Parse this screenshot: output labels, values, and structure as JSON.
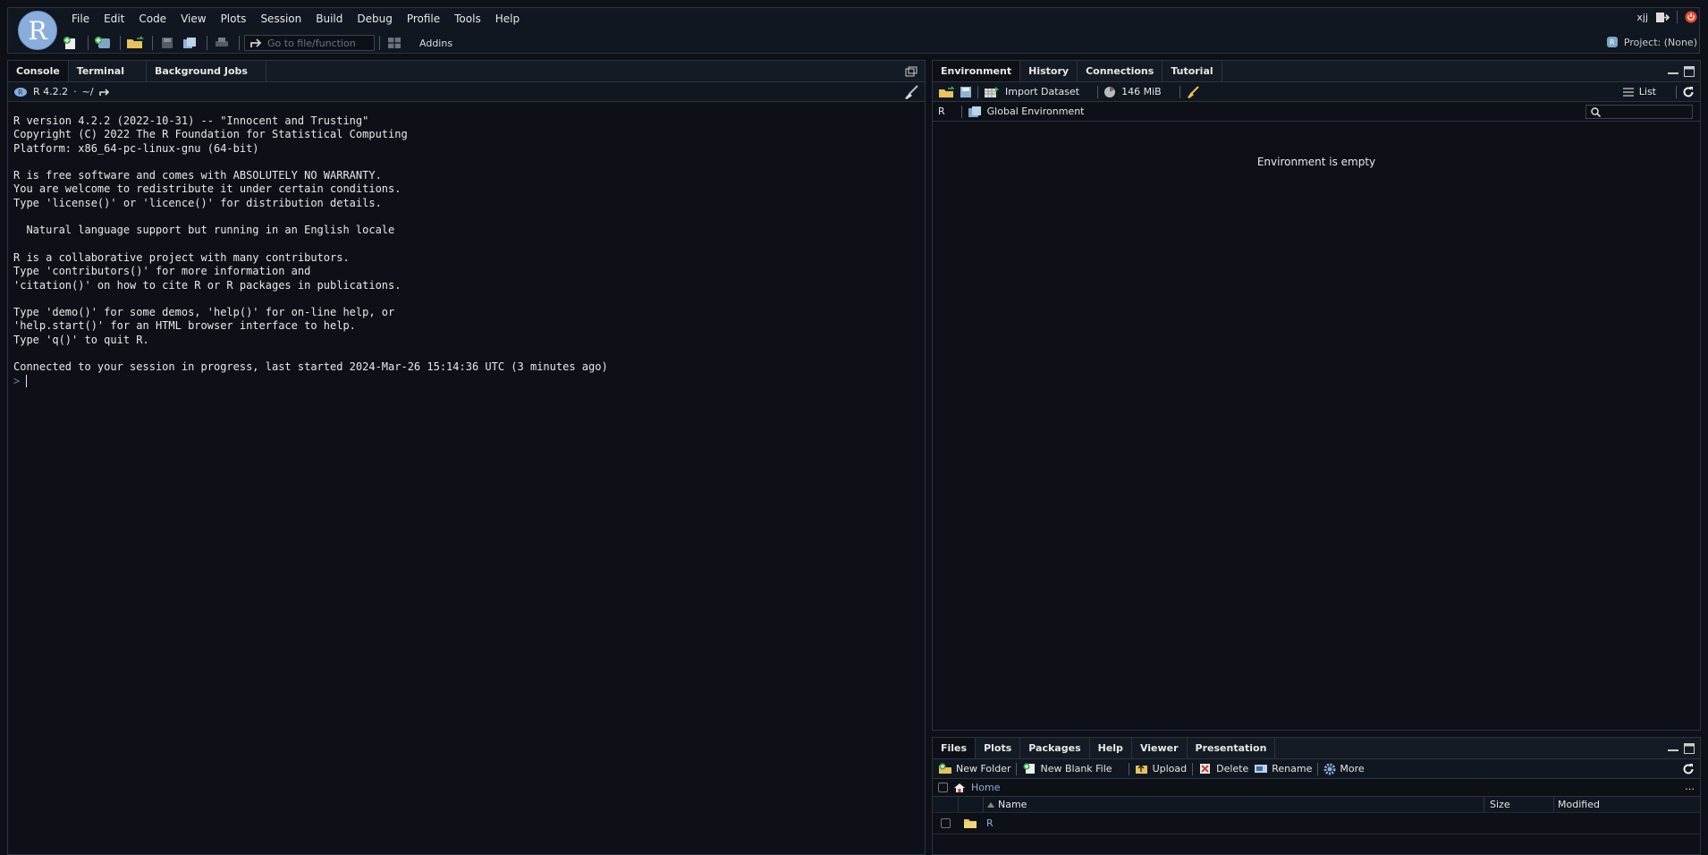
{
  "menu": [
    "File",
    "Edit",
    "Code",
    "View",
    "Plots",
    "Session",
    "Build",
    "Debug",
    "Profile",
    "Tools",
    "Help"
  ],
  "logo_letter": "R",
  "user": "xjj",
  "toolbar": {
    "goto_placeholder": "Go to file/function",
    "addins": "Addins"
  },
  "project": "Project: (None)",
  "console_pane": {
    "tabs": [
      "Console",
      "Terminal",
      "Background Jobs"
    ],
    "r_version": "R 4.2.2",
    "path": "~/",
    "output": "R version 4.2.2 (2022-10-31) -- \"Innocent and Trusting\"\nCopyright (C) 2022 The R Foundation for Statistical Computing\nPlatform: x86_64-pc-linux-gnu (64-bit)\n\nR is free software and comes with ABSOLUTELY NO WARRANTY.\nYou are welcome to redistribute it under certain conditions.\nType 'license()' or 'licence()' for distribution details.\n\n  Natural language support but running in an English locale\n\nR is a collaborative project with many contributors.\nType 'contributors()' for more information and\n'citation()' on how to cite R or R packages in publications.\n\nType 'demo()' for some demos, 'help()' for on-line help, or\n'help.start()' for an HTML browser interface to help.\nType 'q()' to quit R.\n\nConnected to your session in progress, last started 2024-Mar-26 15:14:36 UTC (3 minutes ago)",
    "prompt": ">"
  },
  "env_pane": {
    "tabs": [
      "Environment",
      "History",
      "Connections",
      "Tutorial"
    ],
    "import_dataset": "Import Dataset",
    "memory": "146 MiB",
    "list_label": "List",
    "lang": "R",
    "scope": "Global Environment",
    "empty_message": "Environment is empty"
  },
  "files_pane": {
    "tabs": [
      "Files",
      "Plots",
      "Packages",
      "Help",
      "Viewer",
      "Presentation"
    ],
    "actions": [
      "New Folder",
      "New Blank File",
      "Upload",
      "Delete",
      "Rename",
      "More"
    ],
    "breadcrumb": "Home",
    "columns": [
      "Name",
      "Size",
      "Modified"
    ],
    "rows": [
      {
        "name": "R",
        "size": "",
        "modified": ""
      }
    ]
  },
  "colors": {
    "background": "#0d1117",
    "accent": "#8aaedc",
    "folder": "#e8c25a"
  }
}
